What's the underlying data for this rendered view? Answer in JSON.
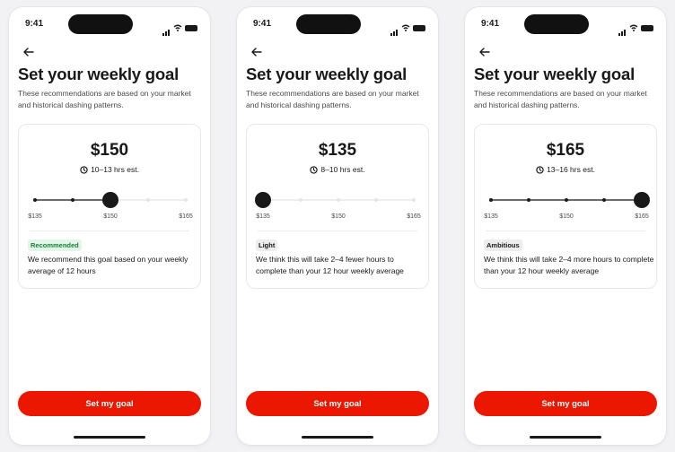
{
  "screens": [
    {
      "status_time": "9:41",
      "title": "Set your weekly goal",
      "subtitle": "These recommendations are based on your market and historical dashing patterns.",
      "amount": "$150",
      "estimate": "10–13 hrs est.",
      "ticks": [
        "$135",
        "$150",
        "$165"
      ],
      "selected_step": 2,
      "badge": "Recommended",
      "badge_style": "green",
      "description": "We recommend this goal based on your weekly average of 12 hours",
      "cta": "Set my goal"
    },
    {
      "status_time": "9:41",
      "title": "Set your weekly goal",
      "subtitle": "These recommendations are based on your market and historical dashing patterns.",
      "amount": "$135",
      "estimate": "8–10 hrs est.",
      "ticks": [
        "$135",
        "$150",
        "$165"
      ],
      "selected_step": 0,
      "badge": "Light",
      "badge_style": "gray",
      "description": "We think this will take 2–4 fewer hours to complete than your 12 hour weekly average",
      "cta": "Set my goal"
    },
    {
      "status_time": "9:41",
      "title": "Set your weekly goal",
      "subtitle": "These recommendations are based on your market and historical dashing patterns.",
      "amount": "$165",
      "estimate": "13–16 hrs est.",
      "ticks": [
        "$135",
        "$150",
        "$165"
      ],
      "selected_step": 4,
      "badge": "Ambitious",
      "badge_style": "gray",
      "description": "We think this will take 2–4 more hours to complete than your 12 hour weekly average",
      "cta": "Set my goal"
    }
  ],
  "slider_steps": 5,
  "colors": {
    "accent": "#eb1700",
    "track_active": "#191919",
    "track_inactive": "#e4e4e4",
    "badge_green_bg": "#e3f5e8",
    "badge_green_text": "#1a7f37",
    "badge_gray_bg": "#ededed"
  },
  "icons": {
    "back": "arrow-left-icon",
    "clock": "clock-icon",
    "signal": "signal-icon",
    "wifi": "wifi-icon",
    "battery": "battery-icon"
  }
}
